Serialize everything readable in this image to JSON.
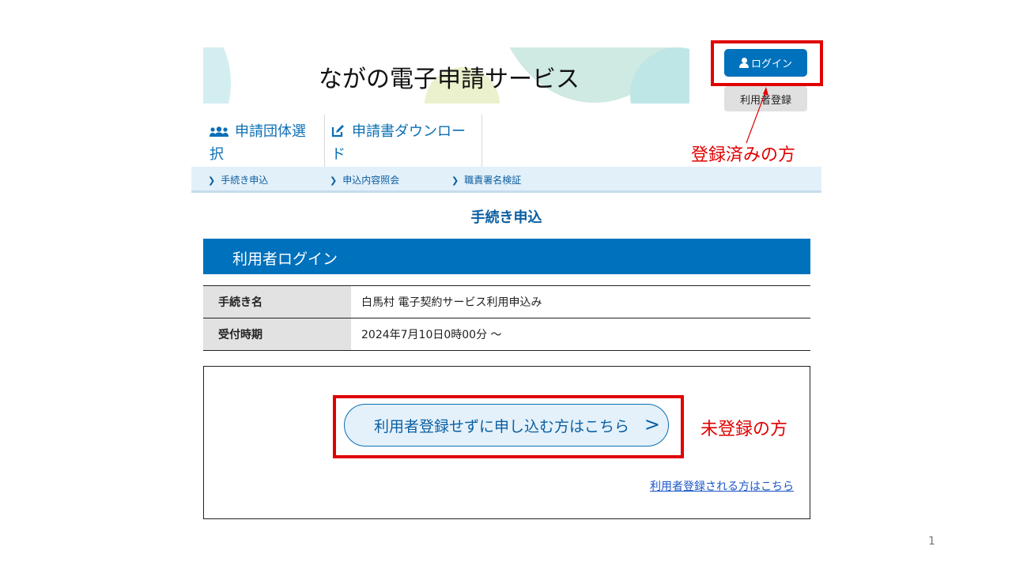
{
  "header": {
    "site_title": "ながの電子申請サービス",
    "login_label": "ログイン",
    "register_label": "利用者登録"
  },
  "nav": {
    "tabs": [
      {
        "label": "申請団体選択",
        "icon": "group-icon"
      },
      {
        "label": "申請書ダウンロード",
        "icon": "edit-icon"
      }
    ]
  },
  "subnav": {
    "items": [
      {
        "label": "手続き申込"
      },
      {
        "label": "申込内容照会"
      },
      {
        "label": "職責署名検証"
      }
    ]
  },
  "main": {
    "heading": "手続き申込",
    "section_title": "利用者ログイン",
    "table": [
      {
        "label": "手続き名",
        "value": "白馬村 電子契約サービス利用申込み"
      },
      {
        "label": "受付時期",
        "value": "2024年7月10日0時00分 〜"
      }
    ],
    "guest_button_label": "利用者登録せずに申し込む方はこちら",
    "guest_button_arrow": ">",
    "register_link_label": "利用者登録される方はこちら"
  },
  "annotations": {
    "registered": "登録済みの方",
    "unregistered": "未登録の方",
    "highlight_color": "#e00000"
  },
  "slide": {
    "page_number": "1"
  },
  "colors": {
    "primary": "#0071bc",
    "subnav_bg": "#e2f0fa"
  }
}
